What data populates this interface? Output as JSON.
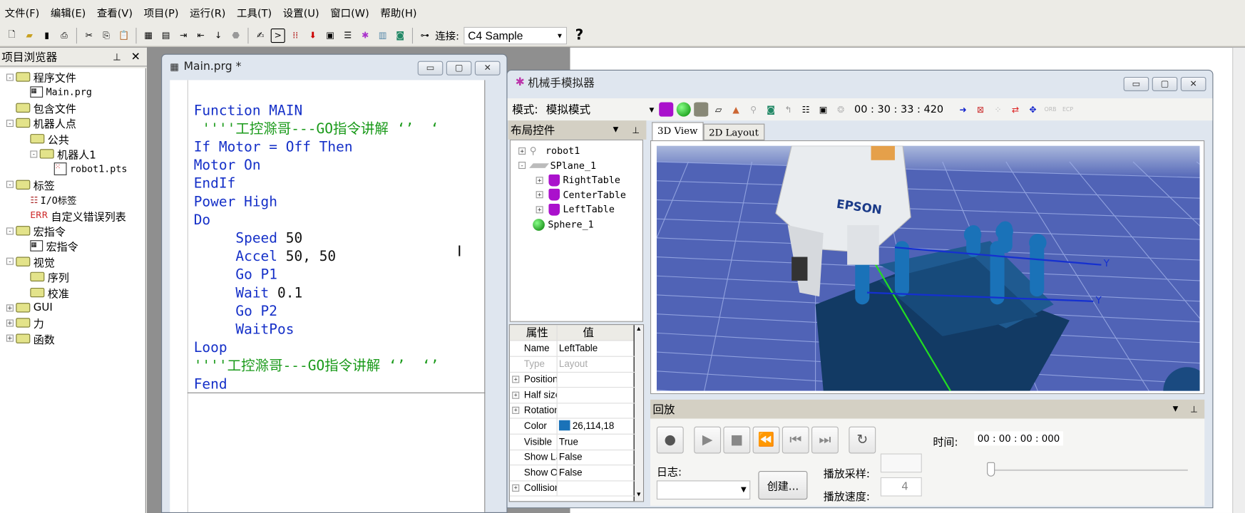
{
  "menu": [
    "文件(F)",
    "编辑(E)",
    "查看(V)",
    "项目(P)",
    "运行(R)",
    "工具(T)",
    "设置(U)",
    "窗口(W)",
    "帮助(H)"
  ],
  "toolbar": {
    "connect_label": "连接:",
    "connection": "C4 Sample",
    "help": "?"
  },
  "project_browser": {
    "title": "项目浏览器",
    "items": [
      {
        "label": "程序文件",
        "level": 0,
        "type": "folder",
        "exp": "-"
      },
      {
        "label": "Main.prg",
        "level": 1,
        "type": "prg"
      },
      {
        "label": "包含文件",
        "level": 0,
        "type": "folder"
      },
      {
        "label": "机器人点",
        "level": 0,
        "type": "folder",
        "exp": "-"
      },
      {
        "label": "公共",
        "level": 1,
        "type": "folder"
      },
      {
        "label": "机器人1",
        "level": 1,
        "type": "folder",
        "exp": "-"
      },
      {
        "label": "robot1.pts",
        "level": 2,
        "type": "pts"
      },
      {
        "label": "标签",
        "level": 0,
        "type": "folder",
        "exp": "-"
      },
      {
        "label": "I/O标签",
        "level": 1,
        "type": "io"
      },
      {
        "label": "自定义错误列表",
        "level": 1,
        "type": "err"
      },
      {
        "label": "宏指令",
        "level": 0,
        "type": "folder",
        "exp": "-"
      },
      {
        "label": "宏指令",
        "level": 1,
        "type": "prg"
      },
      {
        "label": "视觉",
        "level": 0,
        "type": "folder",
        "exp": "-"
      },
      {
        "label": "序列",
        "level": 1,
        "type": "folder"
      },
      {
        "label": "校准",
        "level": 1,
        "type": "folder"
      },
      {
        "label": "GUI",
        "level": 0,
        "type": "folder",
        "exp": "+"
      },
      {
        "label": "力",
        "level": 0,
        "type": "folder",
        "exp": "+"
      },
      {
        "label": "函数",
        "level": 0,
        "type": "folder",
        "exp": "+"
      }
    ]
  },
  "editor": {
    "title": "Main.prg *",
    "lines": [
      [],
      [
        [
          "kw",
          "Function MAIN"
        ]
      ],
      [
        [
          "cm",
          " ''''工控滁哥---GO指令讲解 ‘’  ‘"
        ]
      ],
      [
        [
          "kw",
          "If Motor = Off Then"
        ]
      ],
      [
        [
          "kw",
          "Motor On"
        ]
      ],
      [
        [
          "kw",
          "EndIf"
        ]
      ],
      [
        [
          "kw",
          "Power High"
        ]
      ],
      [
        [
          "kw",
          "Do"
        ]
      ],
      [
        [
          "kw",
          "     Speed "
        ],
        [
          "nm",
          "50"
        ]
      ],
      [
        [
          "kw",
          "     Accel "
        ],
        [
          "nm",
          "50, 50"
        ]
      ],
      [
        [
          "kw",
          "     Go P1"
        ]
      ],
      [
        [
          "kw",
          "     Wait "
        ],
        [
          "nm",
          "0.1"
        ]
      ],
      [
        [
          "kw",
          "     Go P2"
        ]
      ],
      [
        [
          "kw",
          "     WaitPos"
        ]
      ],
      [
        [
          "kw",
          "Loop"
        ]
      ],
      [
        [
          "cm",
          "''''工控滁哥---GO指令讲解 ‘’  ‘’"
        ]
      ],
      [
        [
          "kw",
          "Fend"
        ]
      ]
    ]
  },
  "simulator": {
    "title": "机械手模拟器",
    "mode_label": "模式:",
    "mode": "模拟模式",
    "clock": "00 : 30 : 33 : 420",
    "layout_panel": "布局控件",
    "tabs": [
      "3D View",
      "2D Layout"
    ],
    "active_tab": "3D View",
    "tree": [
      {
        "label": "robot1",
        "level": 0,
        "exp": "+",
        "icon": "robot"
      },
      {
        "label": "SPlane_1",
        "level": 0,
        "exp": "-",
        "icon": "plane"
      },
      {
        "label": "RightTable",
        "level": 1,
        "exp": "+",
        "icon": "box"
      },
      {
        "label": "CenterTable",
        "level": 1,
        "exp": "+",
        "icon": "box"
      },
      {
        "label": "LeftTable",
        "level": 1,
        "exp": "+",
        "icon": "box"
      },
      {
        "label": "Sphere_1",
        "level": 0,
        "icon": "sphere"
      }
    ],
    "props_header": [
      "属性",
      "值"
    ],
    "props": [
      {
        "k": "Name",
        "v": "LeftTable"
      },
      {
        "k": "Type",
        "v": "Layout",
        "disabled": true
      },
      {
        "k": "Position",
        "v": "",
        "exp": true
      },
      {
        "k": "Half size",
        "v": "",
        "exp": true
      },
      {
        "k": "Rotation",
        "v": "",
        "exp": true
      },
      {
        "k": "Color",
        "v": "26,114,18",
        "swatch": "#1a72b8"
      },
      {
        "k": "Visible",
        "v": "True"
      },
      {
        "k": "Show Labe",
        "v": "False"
      },
      {
        "k": "Show Orig",
        "v": "False"
      },
      {
        "k": "Collision",
        "v": "",
        "exp": true
      }
    ],
    "viewport": {
      "robot_brand": "EPSON",
      "axis_label": "Y"
    },
    "playback": {
      "title": "回放",
      "time_label": "时间:",
      "time": "00 : 00 : 00 : 000",
      "log_label": "日志:",
      "create_button": "创建...",
      "sample_label": "播放采样:",
      "speed_label": "播放速度:",
      "speed": "4"
    }
  },
  "colors": {
    "keyword": "#1530c8",
    "comment": "#1a9a1a",
    "floor": "#4f63b8",
    "table": "#123a64",
    "object": "#1a72b8"
  }
}
